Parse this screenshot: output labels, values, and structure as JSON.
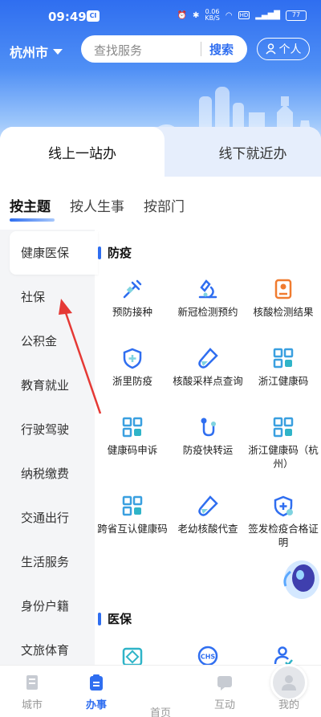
{
  "status": {
    "time": "09:49",
    "app_badge": "CI",
    "net_speed": "0.06",
    "net_unit": "KB/S",
    "battery": "77"
  },
  "header": {
    "city": "杭州市",
    "search_placeholder": "查找服务",
    "search_button": "搜索",
    "personal_button": "个人"
  },
  "main_tabs": [
    "线上一站办",
    "线下就近办"
  ],
  "sub_tabs": [
    "按主题",
    "按人生事",
    "按部门"
  ],
  "sidebar": [
    "健康医保",
    "社保",
    "公积金",
    "教育就业",
    "行驶驾驶",
    "纳税缴费",
    "交通出行",
    "生活服务",
    "身份户籍",
    "文旅体育"
  ],
  "sections": [
    {
      "title": "防疫",
      "items": [
        {
          "label": "预防接种",
          "icon": "syringe-icon"
        },
        {
          "label": "新冠检测预约",
          "icon": "microscope-icon"
        },
        {
          "label": "核酸检测结果",
          "icon": "report-icon"
        },
        {
          "label": "浙里防疫",
          "icon": "shield-plus-icon"
        },
        {
          "label": "核酸采样点查询",
          "icon": "test-tube-icon"
        },
        {
          "label": "浙江健康码",
          "icon": "qr-code-icon"
        },
        {
          "label": "健康码申诉",
          "icon": "qr-code-icon"
        },
        {
          "label": "防疫快转运",
          "icon": "route-icon"
        },
        {
          "label": "浙江健康码（杭州）",
          "icon": "qr-code-icon"
        },
        {
          "label": "跨省互认健康码",
          "icon": "qr-code-icon"
        },
        {
          "label": "老幼核酸代查",
          "icon": "test-tube-icon"
        },
        {
          "label": "签发检疫合格证明",
          "icon": "shield-check-icon"
        }
      ]
    },
    {
      "title": "医保",
      "items": [
        {
          "label": "",
          "icon": "medical-card-icon"
        },
        {
          "label": "",
          "icon": "chs-icon"
        },
        {
          "label": "",
          "icon": "user-check-icon"
        }
      ]
    }
  ],
  "nav": [
    "城市",
    "办事",
    "首页",
    "互动",
    "我的"
  ],
  "colors": {
    "accent": "#2f6ef0",
    "annotation": "#e53935"
  }
}
